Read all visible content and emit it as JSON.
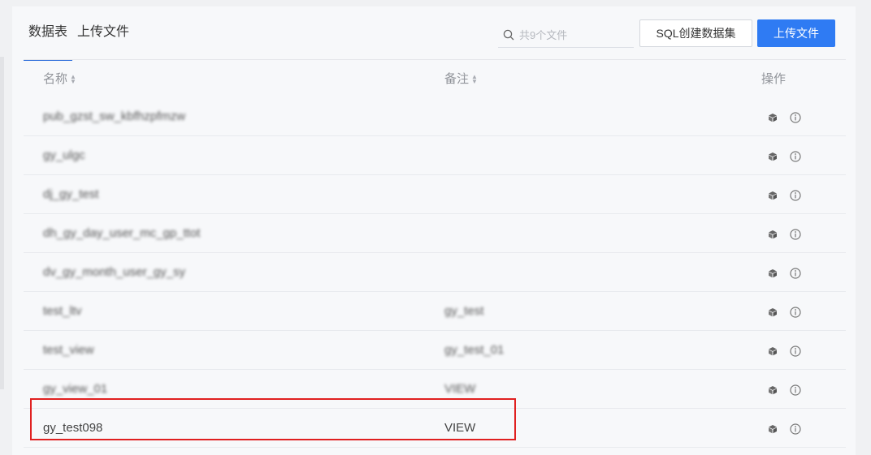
{
  "tabs": [
    {
      "label": "数据表",
      "active": true
    },
    {
      "label": "上传文件",
      "active": false
    }
  ],
  "search": {
    "placeholder": "共9个文件",
    "value": ""
  },
  "buttons": {
    "sql_create": "SQL创建数据集",
    "upload": "上传文件"
  },
  "table": {
    "columns": {
      "name": "名称",
      "remark": "备注",
      "ops": "操作"
    },
    "rows": [
      {
        "name": "pub_gzst_sw_kbfhzpfmzw",
        "remark": ""
      },
      {
        "name": "gy_ulgc",
        "remark": ""
      },
      {
        "name": "dj_gy_test",
        "remark": ""
      },
      {
        "name": "dh_gy_day_user_mc_gp_ttot",
        "remark": ""
      },
      {
        "name": "dv_gy_month_user_gy_sy",
        "remark": ""
      },
      {
        "name": "test_ltv",
        "remark": "gy_test"
      },
      {
        "name": "test_view",
        "remark": "gy_test_01"
      },
      {
        "name": "gy_view_01",
        "remark": "VIEW"
      },
      {
        "name": "gy_test098",
        "remark": "VIEW"
      }
    ]
  },
  "icons": {
    "row_action_1": "cube-icon",
    "row_action_2": "info-icon",
    "search": "search-icon"
  },
  "colors": {
    "accent": "#2f7bf3",
    "highlight": "#e02020"
  }
}
